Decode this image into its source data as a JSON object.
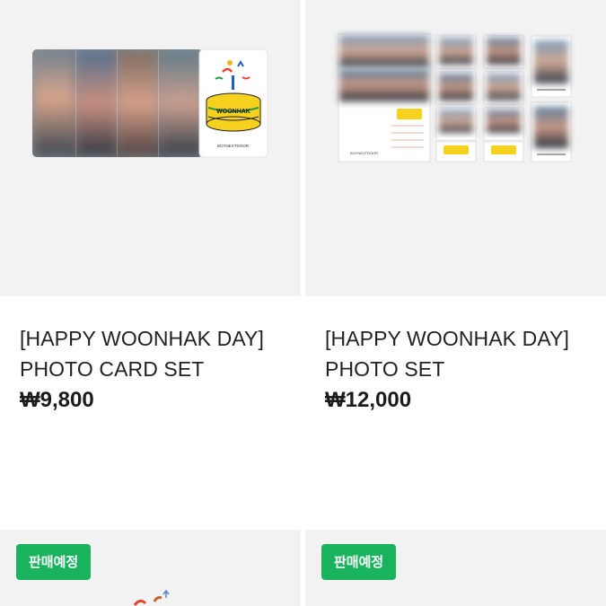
{
  "products": [
    {
      "title_line1": "[HAPPY WOONHAK DAY]",
      "title_line2": "PHOTO CARD SET",
      "price": "₩9,800",
      "image_text": {
        "cake_label": "WOONHAK",
        "brand": "BOYNEXTDOOR"
      }
    },
    {
      "title_line1": "[HAPPY WOONHAK DAY]",
      "title_line2": "PHOTO SET",
      "price": "₩12,000",
      "image_text": {
        "cake_label": "WOONHAK",
        "brand": "BOYNEXTDOOR"
      }
    },
    {
      "badge": "판매예정"
    },
    {
      "badge": "판매예정"
    }
  ],
  "colors": {
    "badge_bg": "#19b35e",
    "thumb_bg": "#f2f2f2"
  }
}
